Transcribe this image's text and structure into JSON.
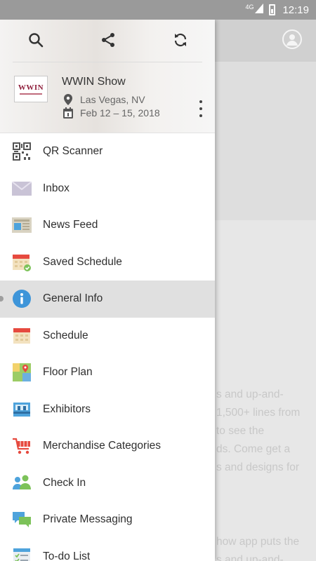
{
  "status_bar": {
    "network": "4G",
    "time": "12:19"
  },
  "background": {
    "lines_a": [
      "s and up-and-",
      "1,500+ lines from",
      "to see the",
      "ds. Come get a",
      "s and designs for"
    ],
    "lines_b": [
      "how app puts the",
      "s and up-and-"
    ]
  },
  "drawer": {
    "header_icons": [
      "search-icon",
      "share-icon",
      "sync-icon"
    ],
    "event": {
      "logo_text": "WWIN",
      "title": "WWIN Show",
      "location": "Las Vegas, NV",
      "dates": "Feb 12 – 15, 2018"
    },
    "menu": [
      {
        "label": "QR Scanner",
        "icon": "qr-code-icon"
      },
      {
        "label": "Inbox",
        "icon": "envelope-icon"
      },
      {
        "label": "News Feed",
        "icon": "newspaper-icon"
      },
      {
        "label": "Saved Schedule",
        "icon": "calendar-check-icon"
      },
      {
        "label": "General Info",
        "icon": "info-icon",
        "active": true
      },
      {
        "label": "Schedule",
        "icon": "calendar-icon"
      },
      {
        "label": "Floor Plan",
        "icon": "map-icon"
      },
      {
        "label": "Exhibitors",
        "icon": "booth-icon"
      },
      {
        "label": "Merchandise Categories",
        "icon": "shopping-cart-icon"
      },
      {
        "label": "Check In",
        "icon": "people-icon"
      },
      {
        "label": "Private Messaging",
        "icon": "chat-bubbles-icon"
      },
      {
        "label": "To-do List",
        "icon": "checklist-icon"
      }
    ]
  },
  "colors": {
    "accent_blue": "#3e95d9",
    "red": "#e64a3f",
    "active_row": "#e0e0e0"
  }
}
